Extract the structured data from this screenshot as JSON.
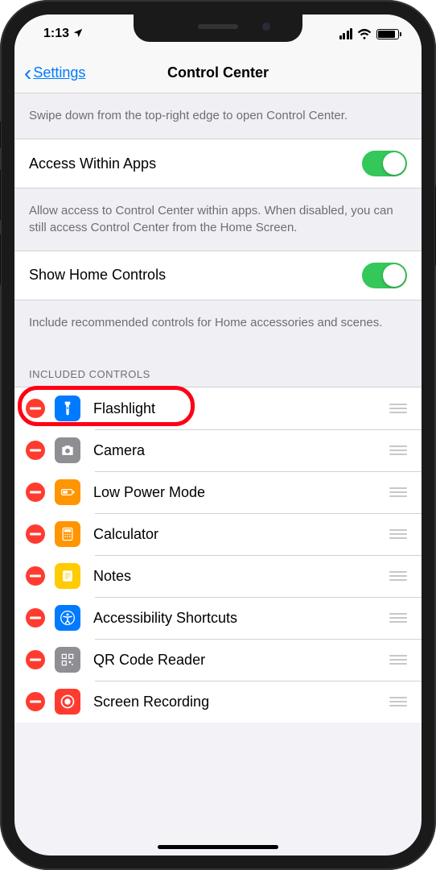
{
  "status": {
    "time": "1:13"
  },
  "nav": {
    "back_label": "Settings",
    "title": "Control Center"
  },
  "intro_text": "Swipe down from the top-right edge to open Control Center.",
  "toggles": {
    "access": {
      "label": "Access Within Apps",
      "footer": "Allow access to Control Center within apps. When disabled, you can still access Control Center from the Home Screen.",
      "on": true
    },
    "home": {
      "label": "Show Home Controls",
      "footer": "Include recommended controls for Home accessories and scenes.",
      "on": true
    }
  },
  "section_header": "INCLUDED CONTROLS",
  "controls": [
    {
      "key": "flashlight",
      "label": "Flashlight",
      "icon": "flashlight",
      "bg": "#007aff"
    },
    {
      "key": "camera",
      "label": "Camera",
      "icon": "camera",
      "bg": "#8e8e93"
    },
    {
      "key": "lowpower",
      "label": "Low Power Mode",
      "icon": "battery",
      "bg": "#ff9500"
    },
    {
      "key": "calculator",
      "label": "Calculator",
      "icon": "calculator",
      "bg": "#ff9500"
    },
    {
      "key": "notes",
      "label": "Notes",
      "icon": "notes",
      "bg": "#ffcc00"
    },
    {
      "key": "accessibility",
      "label": "Accessibility Shortcuts",
      "icon": "accessibility",
      "bg": "#007aff"
    },
    {
      "key": "qrcode",
      "label": "QR Code Reader",
      "icon": "qrcode",
      "bg": "#8e8e93"
    },
    {
      "key": "screenrec",
      "label": "Screen Recording",
      "icon": "record",
      "bg": "#ff3b30"
    }
  ],
  "highlight_index": 0
}
